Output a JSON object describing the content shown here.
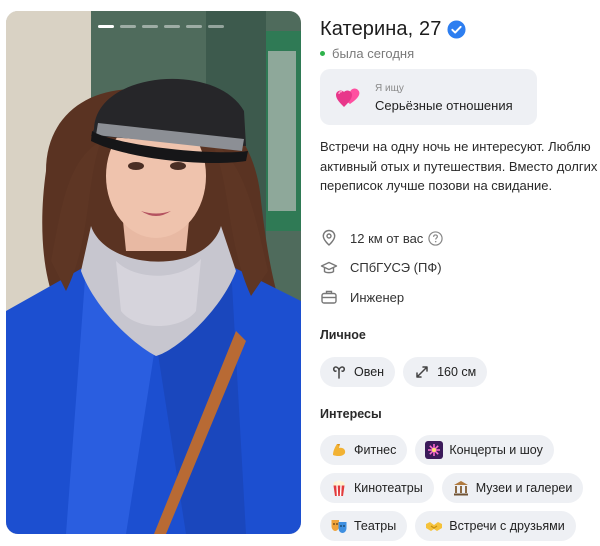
{
  "photo": {
    "count": 6,
    "active": 0
  },
  "profile": {
    "name_age": "Катерина, 27",
    "status": "была сегодня",
    "looking_for": {
      "label": "Я ищу",
      "value": "Серьёзные отношения",
      "icon": "hearts-icon"
    },
    "bio": "Встречи на одну ночь не интересуют. Люблю активный отых и путешествия. Вместо долгих переписок лучше позови на свидание.",
    "distance": "12 км от вас",
    "education": "СПбГУСЭ (ПФ)",
    "job": "Инженер"
  },
  "personal": {
    "title": "Личное",
    "chips": [
      {
        "label": "Овен",
        "icon": "aries-icon"
      },
      {
        "label": "160 см",
        "icon": "height-arrows-icon"
      }
    ]
  },
  "interests": {
    "title": "Интересы",
    "chips": [
      {
        "label": "Фитнес",
        "icon": "flexed-biceps-icon"
      },
      {
        "label": "Концерты и шоу",
        "icon": "fireworks-icon"
      },
      {
        "label": "Кинотеатры",
        "icon": "popcorn-icon"
      },
      {
        "label": "Музеи и галереи",
        "icon": "museum-icon"
      },
      {
        "label": "Театры",
        "icon": "theater-masks-icon"
      },
      {
        "label": "Встречи с друзьями",
        "icon": "handshake-icon"
      }
    ]
  },
  "colors": {
    "accent": "#2d7ef0",
    "online": "#2eb24b",
    "chip_bg": "#eef0f4"
  }
}
